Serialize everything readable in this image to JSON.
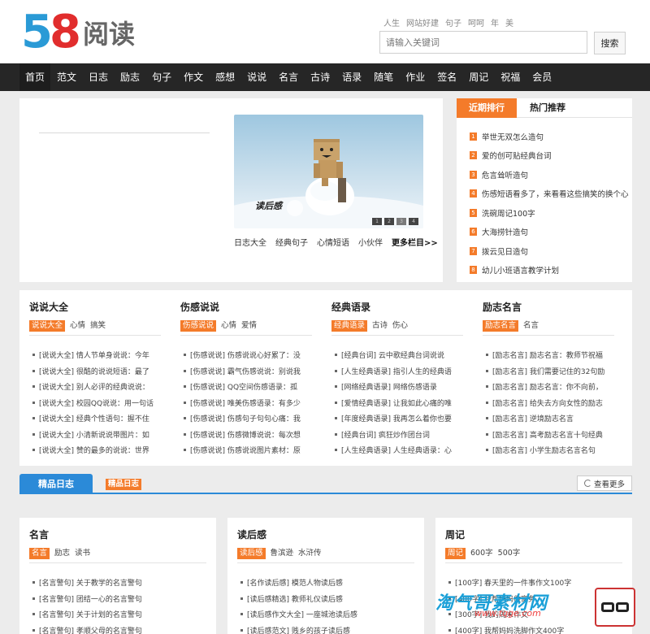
{
  "logo": {
    "num5": "5",
    "num8": "8",
    "text": "阅读"
  },
  "header": {
    "hot_words": [
      "人生",
      "网站好建",
      "句子",
      "呵呵",
      "年",
      "美"
    ],
    "search_placeholder": "请输入关键词",
    "search_button": "搜索"
  },
  "nav": [
    "首页",
    "范文",
    "日志",
    "励志",
    "句子",
    "作文",
    "感想",
    "说说",
    "名言",
    "古诗",
    "语录",
    "随笔",
    "作业",
    "签名",
    "周记",
    "祝福",
    "会员"
  ],
  "slideshow": {
    "label": "读后感",
    "dots": [
      "1",
      "2",
      "3",
      "4"
    ],
    "links": [
      "日志大全",
      "经典句子",
      "心情短语",
      "小伙伴"
    ],
    "more": "更多栏目>>"
  },
  "rank": {
    "tabs": [
      "近期排行",
      "热门推荐"
    ],
    "items": [
      {
        "n": "1",
        "t": "举世无双怎么造句"
      },
      {
        "n": "2",
        "t": "爱的创可贴经典台词"
      },
      {
        "n": "3",
        "t": "危言耸听造句"
      },
      {
        "n": "4",
        "t": "伤感短语看多了，来看看这些搞笑的换个心"
      },
      {
        "n": "5",
        "t": "洗碗周记100字"
      },
      {
        "n": "6",
        "t": "大海捞针造句"
      },
      {
        "n": "7",
        "t": "拨云见日造句"
      },
      {
        "n": "8",
        "t": "幼儿小班语言教学计划"
      }
    ]
  },
  "categories": [
    {
      "title": "说说大全",
      "tags": [
        "说说大全",
        "心情",
        "搞笑"
      ],
      "items": [
        "[说说大全] 情人节单身说说：今年",
        "[说说大全] 很酷的说说短语：最了",
        "[说说大全] 别人必评的经典说说：",
        "[说说大全] 校园QQ说说：用一句话",
        "[说说大全] 经典个性语句：握不住",
        "[说说大全] 小清新说说带图片：如",
        "[说说大全] 赞的最多的说说：世界"
      ]
    },
    {
      "title": "伤感说说",
      "tags": [
        "伤感说说",
        "心情",
        "爱情"
      ],
      "items": [
        "[伤感说说] 伤感说说心好累了：没",
        "[伤感说说] 霸气伤感说说：别说我",
        "[伤感说说] QQ空间伤感语录：孤",
        "[伤感说说] 唯美伤感语录：有多少",
        "[伤感说说] 伤感句子句句心痛：我",
        "[伤感说说] 伤感微博说说：每次想",
        "[伤感说说] 伤感说说图片素材：原"
      ]
    },
    {
      "title": "经典语录",
      "tags": [
        "经典语录",
        "古诗",
        "伤心"
      ],
      "items": [
        "[经典台词] 云中歌经典台词说说",
        "[人生经典语录] 指引人生的经典语",
        "[网络经典语录] 网络伤感语录",
        "[爱情经典语录] 让我如此心痛的唯",
        "[年度经典语录] 我再怎么着你也要",
        "[经典台词] 疯狂炒作团台词",
        "[人生经典语录] 人生经典语录：心"
      ]
    },
    {
      "title": "励志名言",
      "tags": [
        "励志名言",
        "名言"
      ],
      "items": [
        "[励志名言] 励志名言：教师节祝福",
        "[励志名言] 我们需要记住的32句励",
        "[励志名言] 励志名言：你不向前，",
        "[励志名言] 给失去方向女性的励志",
        "[励志名言] 逆境励志名言",
        "[励志名言] 高考励志名言十句经典",
        "[励志名言] 小学生励志名言名句"
      ]
    }
  ],
  "featured": {
    "tab": "精品日志",
    "badge": "精品日志",
    "see_more": "查看更多"
  },
  "bottom_cards": [
    {
      "title": "名言",
      "tags": [
        "名言",
        "励志",
        "读书"
      ],
      "items": [
        "[名言警句] 关于教学的名言警句",
        "[名言警句] 团结一心的名言警句",
        "[名言警句] 关于计划的名言警句",
        "[名言警句] 孝顺父母的名言警句"
      ]
    },
    {
      "title": "读后感",
      "tags": [
        "读后感",
        "鲁滨逊",
        "水浒传"
      ],
      "items": [
        "[名作读后感] 模范人物读后感",
        "[读后感精选] 教师礼仪读后感",
        "[读后感作文大全] 一座城池读后感",
        "[读后感范文] 贱乡的孩子读后感"
      ]
    },
    {
      "title": "周记",
      "tags": [
        "周记",
        "600字",
        "500字"
      ],
      "items": [
        "[100字] 春天里的一件事作文100字",
        "[400字] 我帮妈妈做家务",
        "[300字] 我的周末作文",
        "[400字] 我帮妈妈洗脚作文400字"
      ]
    }
  ],
  "watermark": {
    "text": "淘气哥素材网",
    "url": "www.tqge.com"
  }
}
